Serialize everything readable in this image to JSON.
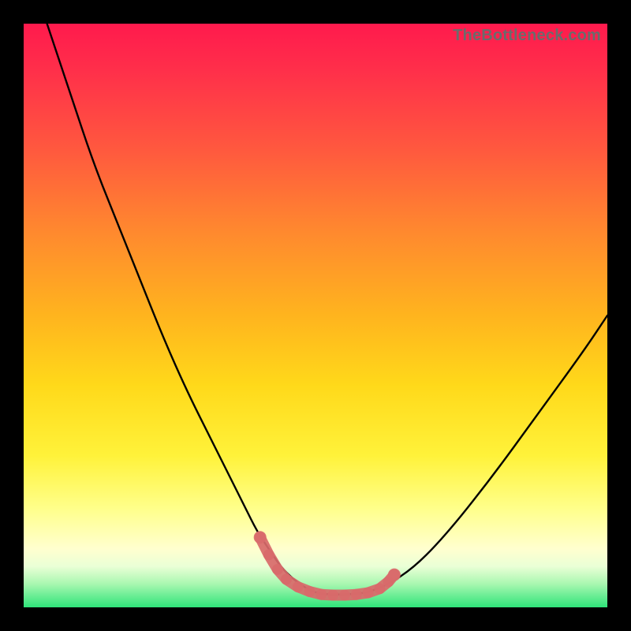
{
  "watermark": "TheBottleneck.com",
  "colors": {
    "curve": "#000000",
    "marker": "#d96b6b",
    "marker_alpha": 0.92
  },
  "chart_data": {
    "type": "line",
    "title": "",
    "xlabel": "",
    "ylabel": "",
    "xlim": [
      0,
      100
    ],
    "ylim": [
      0,
      100
    ],
    "grid": false,
    "legend": false,
    "series": [
      {
        "name": "bottleneck-curve",
        "x": [
          4,
          8,
          12,
          16,
          20,
          24,
          28,
          32,
          36,
          38,
          40,
          42,
          44,
          46,
          48,
          50,
          52,
          56,
          60,
          66,
          72,
          80,
          88,
          96,
          100
        ],
        "y": [
          100,
          88,
          76,
          66,
          56,
          46,
          37,
          29,
          21,
          17,
          13,
          10,
          7,
          5,
          3.5,
          2.5,
          2.2,
          2.2,
          2.7,
          6,
          12,
          22,
          33,
          44,
          50
        ]
      }
    ],
    "markers": {
      "name": "sweet-spot-markers",
      "shape": "rounded-bar",
      "color": "#d96b6b",
      "points": [
        {
          "x": 40.5,
          "y": 12.0
        },
        {
          "x": 42.0,
          "y": 9.0
        },
        {
          "x": 43.5,
          "y": 6.5
        },
        {
          "x": 45.0,
          "y": 4.8
        },
        {
          "x": 47.0,
          "y": 3.5
        },
        {
          "x": 49.0,
          "y": 2.7
        },
        {
          "x": 51.0,
          "y": 2.2
        },
        {
          "x": 53.0,
          "y": 2.1
        },
        {
          "x": 55.0,
          "y": 2.1
        },
        {
          "x": 57.0,
          "y": 2.2
        },
        {
          "x": 59.0,
          "y": 2.5
        },
        {
          "x": 61.0,
          "y": 3.2
        },
        {
          "x": 62.5,
          "y": 4.4
        },
        {
          "x": 63.5,
          "y": 5.6
        }
      ]
    }
  }
}
